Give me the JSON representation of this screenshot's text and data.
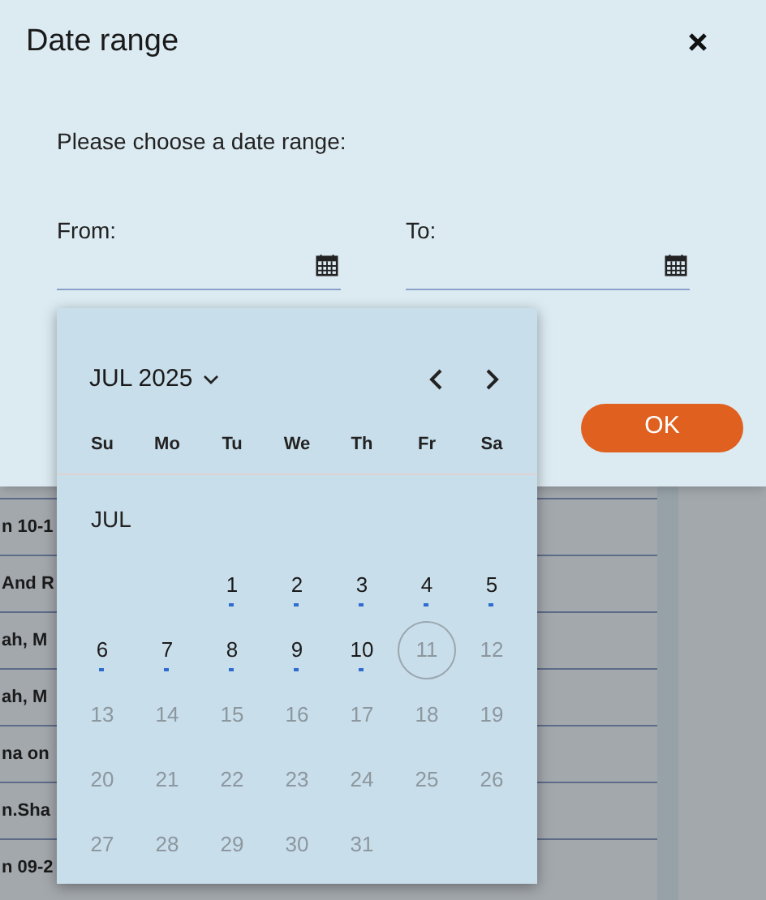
{
  "dialog": {
    "title": "Date range",
    "prompt": "Please choose a date range:",
    "fields": [
      {
        "label": "From:"
      },
      {
        "label": "To:"
      }
    ],
    "ok_button": "OK"
  },
  "calendar": {
    "month_year": "JUL 2025",
    "weekdays": [
      "Su",
      "Mo",
      "Tu",
      "We",
      "Th",
      "Fr",
      "Sa"
    ],
    "month_label": "JUL",
    "weeks": [
      [
        {
          "kind": "blank"
        },
        {
          "kind": "blank"
        },
        {
          "kind": "day",
          "day": "1",
          "disabled": false,
          "dot": true,
          "today": false
        },
        {
          "kind": "day",
          "day": "2",
          "disabled": false,
          "dot": true,
          "today": false
        },
        {
          "kind": "day",
          "day": "3",
          "disabled": false,
          "dot": true,
          "today": false
        },
        {
          "kind": "day",
          "day": "4",
          "disabled": false,
          "dot": true,
          "today": false
        },
        {
          "kind": "day",
          "day": "5",
          "disabled": false,
          "dot": true,
          "today": false
        }
      ],
      [
        {
          "kind": "day",
          "day": "6",
          "disabled": false,
          "dot": true,
          "today": false
        },
        {
          "kind": "day",
          "day": "7",
          "disabled": false,
          "dot": true,
          "today": false
        },
        {
          "kind": "day",
          "day": "8",
          "disabled": false,
          "dot": true,
          "today": false
        },
        {
          "kind": "day",
          "day": "9",
          "disabled": false,
          "dot": true,
          "today": false
        },
        {
          "kind": "day",
          "day": "10",
          "disabled": false,
          "dot": true,
          "today": false
        },
        {
          "kind": "day",
          "day": "11",
          "disabled": true,
          "dot": false,
          "today": true
        },
        {
          "kind": "day",
          "day": "12",
          "disabled": true,
          "dot": false,
          "today": false
        }
      ],
      [
        {
          "kind": "day",
          "day": "13",
          "disabled": true,
          "dot": false,
          "today": false
        },
        {
          "kind": "day",
          "day": "14",
          "disabled": true,
          "dot": false,
          "today": false
        },
        {
          "kind": "day",
          "day": "15",
          "disabled": true,
          "dot": false,
          "today": false
        },
        {
          "kind": "day",
          "day": "16",
          "disabled": true,
          "dot": false,
          "today": false
        },
        {
          "kind": "day",
          "day": "17",
          "disabled": true,
          "dot": false,
          "today": false
        },
        {
          "kind": "day",
          "day": "18",
          "disabled": true,
          "dot": false,
          "today": false
        },
        {
          "kind": "day",
          "day": "19",
          "disabled": true,
          "dot": false,
          "today": false
        }
      ],
      [
        {
          "kind": "day",
          "day": "20",
          "disabled": true,
          "dot": false,
          "today": false
        },
        {
          "kind": "day",
          "day": "21",
          "disabled": true,
          "dot": false,
          "today": false
        },
        {
          "kind": "day",
          "day": "22",
          "disabled": true,
          "dot": false,
          "today": false
        },
        {
          "kind": "day",
          "day": "23",
          "disabled": true,
          "dot": false,
          "today": false
        },
        {
          "kind": "day",
          "day": "24",
          "disabled": true,
          "dot": false,
          "today": false
        },
        {
          "kind": "day",
          "day": "25",
          "disabled": true,
          "dot": false,
          "today": false
        },
        {
          "kind": "day",
          "day": "26",
          "disabled": true,
          "dot": false,
          "today": false
        }
      ],
      [
        {
          "kind": "day",
          "day": "27",
          "disabled": true,
          "dot": false,
          "today": false
        },
        {
          "kind": "day",
          "day": "28",
          "disabled": true,
          "dot": false,
          "today": false
        },
        {
          "kind": "day",
          "day": "29",
          "disabled": true,
          "dot": false,
          "today": false
        },
        {
          "kind": "day",
          "day": "30",
          "disabled": true,
          "dot": false,
          "today": false
        },
        {
          "kind": "day",
          "day": "31",
          "disabled": true,
          "dot": false,
          "today": false
        }
      ]
    ]
  },
  "background_rows": [
    {
      "text": "n 10-1"
    },
    {
      "text": "And R"
    },
    {
      "text": "ah, M"
    },
    {
      "text": "ah, M"
    },
    {
      "text": "na on"
    },
    {
      "text": "n.Sha"
    },
    {
      "text": "n 09-2"
    }
  ]
}
